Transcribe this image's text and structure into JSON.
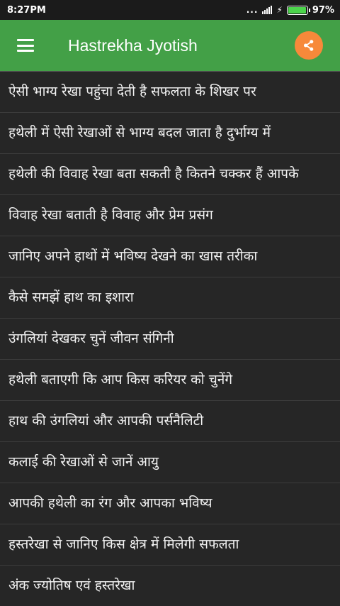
{
  "status_bar": {
    "time": "8:27PM",
    "network_dots": "...",
    "battery_percent": "97%",
    "battery_level": 0.97
  },
  "app_bar": {
    "title": "Hastrekha Jyotish",
    "menu_icon": "hamburger-menu-icon",
    "share_icon": "share-icon",
    "accent_color": "#43a047",
    "share_color": "#f7893a"
  },
  "list": {
    "items": [
      "ऐसी भाग्य रेखा पहुंचा देती है सफलता के शिखर पर",
      "हथेली में ऐसी रेखाओं से भाग्य बदल जाता है दुर्भाग्य में",
      "हथेली की विवाह रेखा बता सकती है कितने चक्कर हैं आपके",
      "विवाह रेखा बताती है विवाह और प्रेम प्रसंग",
      "जानिए अपने हाथों में भविष्य देखने का खास तरीका",
      "कैसे समझें हाथ का इशारा",
      "उंगलियां देखकर चुनें जीवन संगिनी",
      "हथेली बताएगी कि आप किस करियर को चुनेंगे",
      "हाथ की उंगलियां और आपकी पर्सनैलिटी",
      "कलाई की रेखाओं से जानें आयु",
      "आपकी हथेली का रंग और आपका भविष्य",
      "हस्तरेखा से जानिए किस क्षेत्र में मिलेगी सफलता",
      "अंक ज्योतिष एवं हस्तरेखा"
    ]
  }
}
